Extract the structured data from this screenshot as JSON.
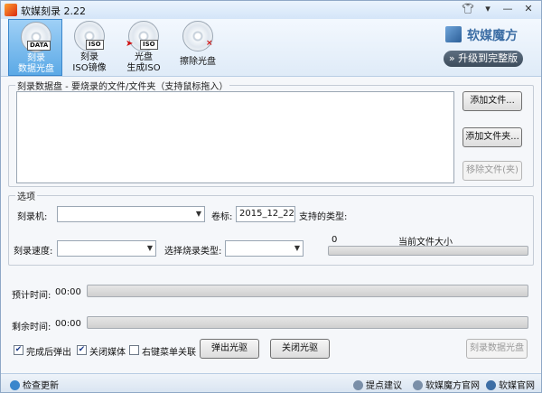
{
  "window": {
    "title": "软媒刻录 2.22"
  },
  "toolbar": {
    "tools": [
      {
        "tag": "DATA",
        "line1": "刻录",
        "line2": "数据光盘"
      },
      {
        "tag": "ISO",
        "line1": "刻录",
        "line2": "ISO镜像"
      },
      {
        "tag": "ISO",
        "line1": "光盘",
        "line2": "生成ISO"
      },
      {
        "tag": "×",
        "line1": "擦除光盘",
        "line2": ""
      }
    ],
    "brand": "软媒魔方",
    "upgrade": "升级到完整版"
  },
  "files": {
    "group_title": "刻录数据盘 - 要烧录的文件/文件夹（支持鼠标拖入）",
    "add_file": "添加文件...",
    "add_folder": "添加文件夹...",
    "remove": "移除文件(夹)"
  },
  "options": {
    "group_title": "选项",
    "burner_label": "刻录机:",
    "burner_value": "",
    "volume_label": "卷标:",
    "volume_value": "2015_12_22",
    "supported_label": "支持的类型:",
    "speed_label": "刻录速度:",
    "speed_value": "",
    "burn_type_label": "选择烧录类型:",
    "burn_type_value": "",
    "size_value": "0",
    "size_label": "当前文件大小",
    "size_fill": 0
  },
  "progress": {
    "estimated_label": "预计时间:",
    "estimated_value": "00:00",
    "remaining_label": "剩余时间:",
    "remaining_value": "00:00"
  },
  "actions": {
    "eject_after": {
      "label": "完成后弹出",
      "checked": true
    },
    "close_media": {
      "label": "关闭媒体",
      "checked": true
    },
    "context_menu": {
      "label": "右键菜单关联",
      "checked": false
    },
    "eject_button": "弹出光驱",
    "close_button": "关闭光驱",
    "burn_button": "刻录数据光盘"
  },
  "statusbar": {
    "check_update": "检查更新",
    "feedback": "提点建议",
    "site": "软媒魔方官网",
    "official": "软媒官网"
  },
  "colors": {
    "active_tool": "#5ba9e6",
    "brand": "#3d6ea5",
    "accent_red": "#d01010"
  }
}
